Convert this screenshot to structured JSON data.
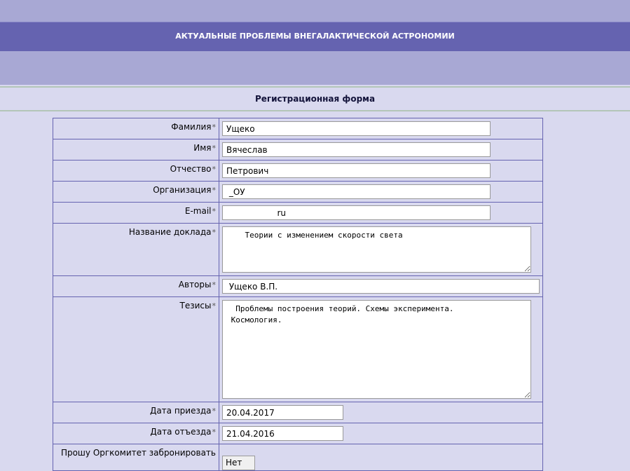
{
  "header": {
    "title": "АКТУАЛЬНЫЕ ПРОБЛЕМЫ ВНЕГАЛАКТИЧЕСКОЙ АСТРОНОМИИ"
  },
  "form": {
    "heading": "Регистрационная форма",
    "required_mark": "*",
    "fields": {
      "surname": {
        "label": "Фамилия",
        "value": "Ущеко"
      },
      "name": {
        "label": "Имя",
        "value": "Вячеслав"
      },
      "patronymic": {
        "label": "Отчество",
        "value": "Петрович"
      },
      "organization": {
        "label": "Организация",
        "value": " _ОУ"
      },
      "email": {
        "label": "E-mail",
        "value": "                   ru"
      },
      "report_title": {
        "label": "Название доклада",
        "value": "    Теории с изменением скорости света"
      },
      "authors": {
        "label": "Авторы",
        "value": " Ущеко В.П."
      },
      "abstract": {
        "label": "Тезисы",
        "value": "  Проблемы построения теорий. Схемы эксперимента.\n Космология."
      },
      "arrival_date": {
        "label": "Дата приезда",
        "value": "20.04.2017"
      },
      "departure_date": {
        "label": "Дата отъезда",
        "value": "21.04.2016"
      },
      "booking": {
        "label": "Прошу Оргкомитет забронировать",
        "value": "Нет"
      }
    }
  }
}
